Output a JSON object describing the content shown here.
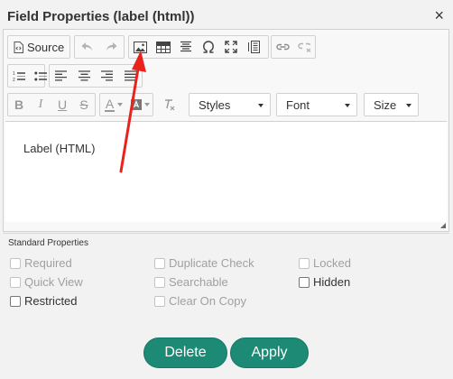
{
  "dialog": {
    "title": "Field Properties (label (html))",
    "close_glyph": "×"
  },
  "toolbar": {
    "source_label": "Source",
    "styles_label": "Styles",
    "font_label": "Font",
    "size_label": "Size",
    "text_color_glyph": "A"
  },
  "editor": {
    "content": "Label (HTML)"
  },
  "standard_properties": {
    "heading": "Standard Properties",
    "required": "Required",
    "quick_view": "Quick View",
    "restricted": "Restricted",
    "duplicate_check": "Duplicate Check",
    "searchable": "Searchable",
    "clear_on_copy": "Clear On Copy",
    "locked": "Locked",
    "hidden": "Hidden"
  },
  "actions": {
    "delete_label": "Delete",
    "apply_label": "Apply"
  },
  "colors": {
    "accent": "#1c8a74",
    "annotation": "#e8231e"
  }
}
